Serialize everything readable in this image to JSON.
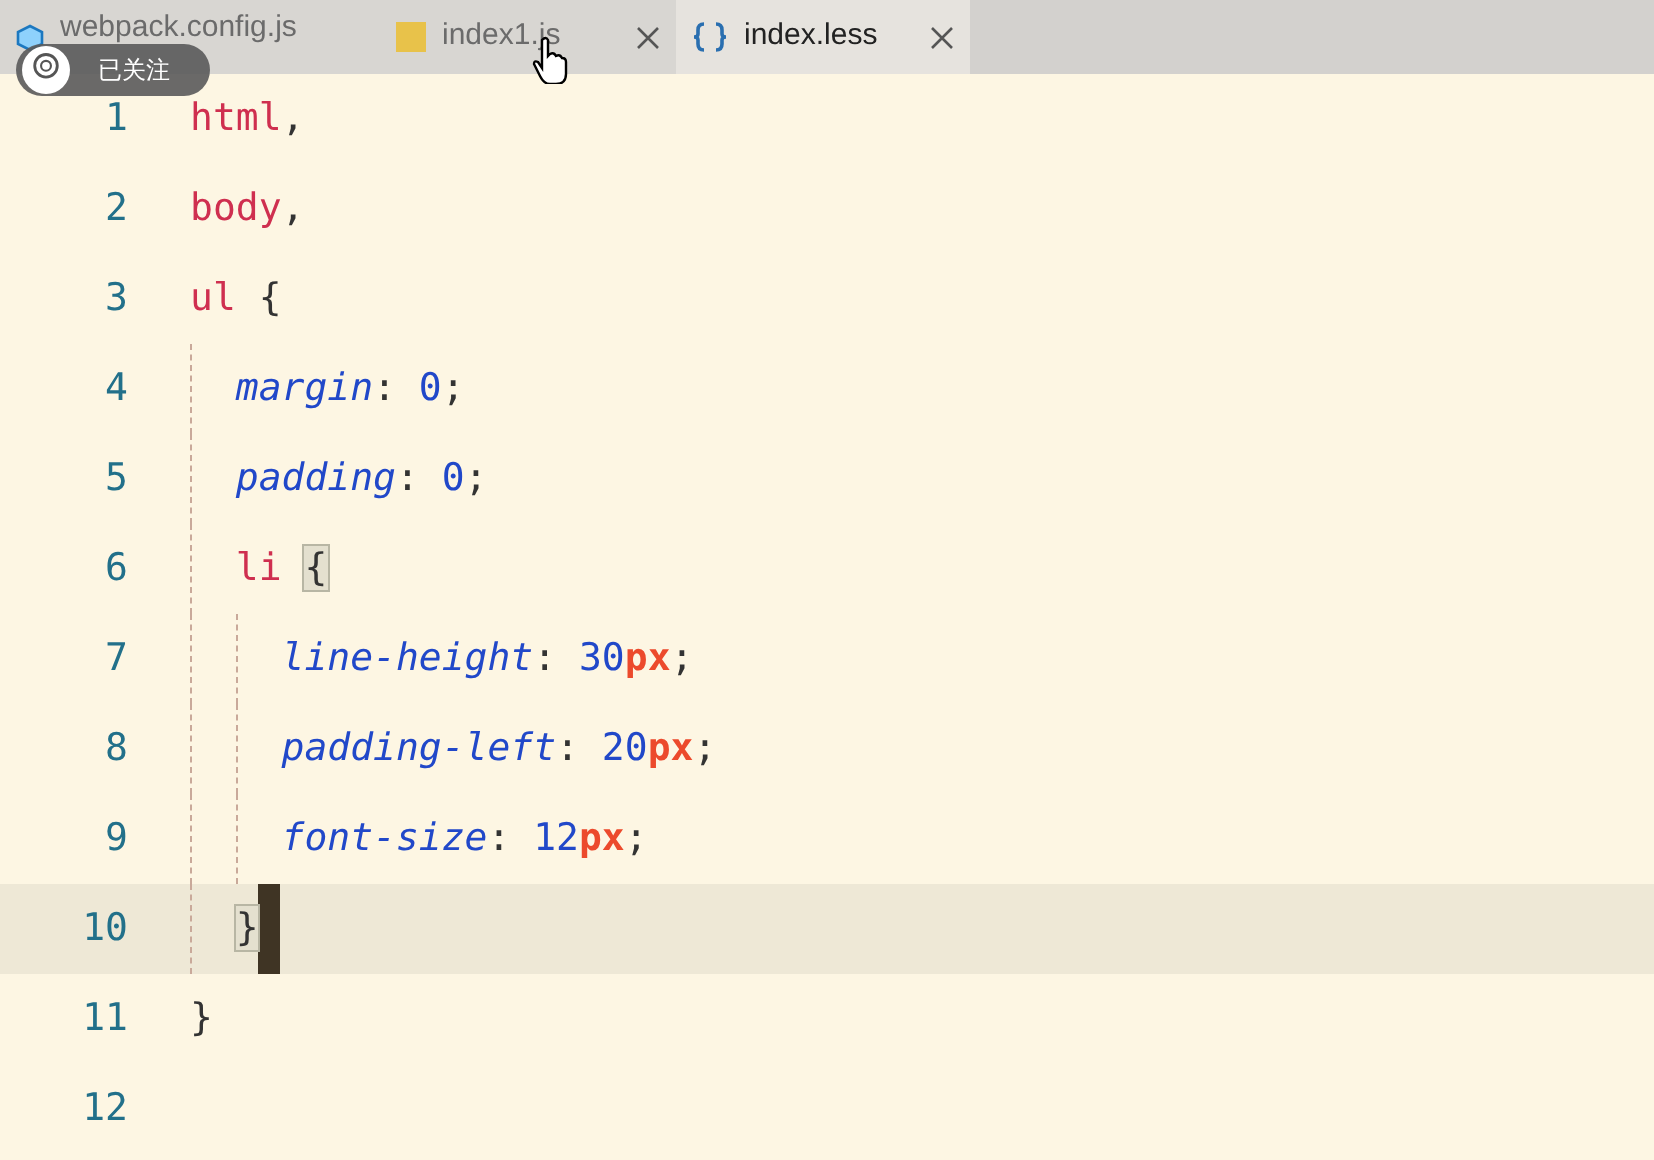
{
  "tabs": [
    {
      "label": "webpack.config.js",
      "selected": false,
      "closable": false
    },
    {
      "label": "index1.js",
      "selected": false,
      "closable": true
    },
    {
      "label": "index.less",
      "selected": true,
      "closable": true
    }
  ],
  "overlay_badge": {
    "label": "已关注"
  },
  "editor": {
    "lines": [
      {
        "number": "1",
        "current": false,
        "tokens": [
          {
            "text": "html",
            "kind": "selector"
          },
          {
            "text": ",",
            "kind": "punct"
          }
        ]
      },
      {
        "number": "2",
        "current": false,
        "tokens": [
          {
            "text": "body",
            "kind": "selector"
          },
          {
            "text": ",",
            "kind": "punct"
          }
        ]
      },
      {
        "number": "3",
        "current": false,
        "tokens": [
          {
            "text": "ul",
            "kind": "selector"
          },
          {
            "text": " {",
            "kind": "punct"
          }
        ],
        "children": [
          {
            "number": "4",
            "current": false,
            "tokens": [
              {
                "text": "margin",
                "kind": "property"
              },
              {
                "text": ": ",
                "kind": "punct"
              },
              {
                "text": "0",
                "kind": "number"
              },
              {
                "text": ";",
                "kind": "punct"
              }
            ]
          },
          {
            "number": "5",
            "current": false,
            "tokens": [
              {
                "text": "padding",
                "kind": "property"
              },
              {
                "text": ": ",
                "kind": "punct"
              },
              {
                "text": "0",
                "kind": "number"
              },
              {
                "text": ";",
                "kind": "punct"
              }
            ]
          },
          {
            "number": "6",
            "current": false,
            "tokens": [
              {
                "text": "li",
                "kind": "selector"
              },
              {
                "text": "{",
                "kind": "brace-match"
              }
            ],
            "children": [
              {
                "number": "7",
                "current": false,
                "tokens": [
                  {
                    "text": "line-height",
                    "kind": "property"
                  },
                  {
                    "text": ": ",
                    "kind": "punct"
                  },
                  {
                    "text": "30",
                    "kind": "number"
                  },
                  {
                    "text": "px",
                    "kind": "unit"
                  },
                  {
                    "text": ";",
                    "kind": "punct"
                  }
                ]
              },
              {
                "number": "8",
                "current": false,
                "tokens": [
                  {
                    "text": "padding-left",
                    "kind": "property"
                  },
                  {
                    "text": ": ",
                    "kind": "punct"
                  },
                  {
                    "text": "20",
                    "kind": "number"
                  },
                  {
                    "text": "px",
                    "kind": "unit"
                  },
                  {
                    "text": ";",
                    "kind": "punct"
                  }
                ]
              },
              {
                "number": "9",
                "current": false,
                "tokens": [
                  {
                    "text": "font-size",
                    "kind": "property"
                  },
                  {
                    "text": ": ",
                    "kind": "punct"
                  },
                  {
                    "text": "12",
                    "kind": "number"
                  },
                  {
                    "text": "px",
                    "kind": "unit"
                  },
                  {
                    "text": ";",
                    "kind": "punct"
                  }
                ]
              }
            ]
          },
          {
            "number": "10",
            "current": true,
            "tokens": [
              {
                "text": "}",
                "kind": "brace-match"
              }
            ]
          }
        ]
      },
      {
        "number": "11",
        "current": false,
        "tokens": [
          {
            "text": "}",
            "kind": "punct"
          }
        ]
      },
      {
        "number": "12",
        "current": false
      }
    ]
  }
}
